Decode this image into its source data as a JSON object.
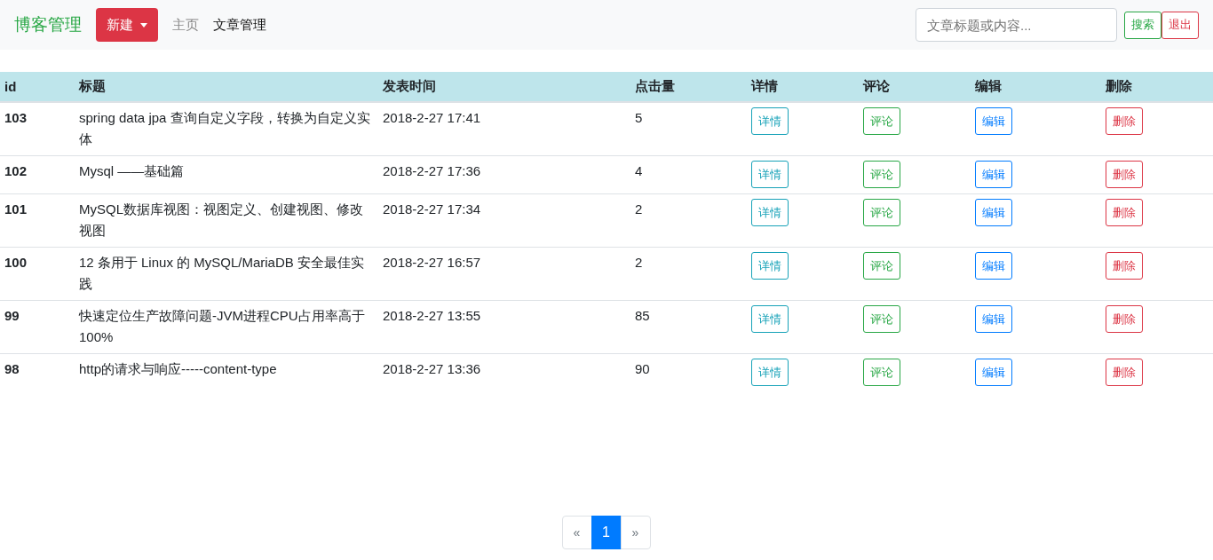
{
  "navbar": {
    "brand": "博客管理",
    "new_button": {
      "label": "新建"
    },
    "links": [
      {
        "label": "主页",
        "selected": false
      },
      {
        "label": "文章管理",
        "selected": true
      }
    ],
    "search": {
      "placeholder": "文章标题或内容..."
    },
    "buttons": [
      {
        "label": "搜索",
        "kind": "success"
      },
      {
        "label": "退出",
        "kind": "danger"
      }
    ]
  },
  "table": {
    "columns": [
      "id",
      "标题",
      "发表时间",
      "点击量",
      "详情",
      "评论",
      "编辑",
      "删除"
    ],
    "rows": [
      {
        "id": "103",
        "title": "spring data jpa 查询自定义字段，转换为自定义实体",
        "time": "2018-2-27 17:41",
        "clicks": "5",
        "actions": [
          {
            "label": "详情",
            "kind": "info"
          },
          {
            "label": "评论",
            "kind": "success"
          },
          {
            "label": "编辑",
            "kind": "primary"
          },
          {
            "label": "删除",
            "kind": "danger"
          }
        ]
      },
      {
        "id": "102",
        "title": "Mysql ——基础篇",
        "time": "2018-2-27 17:36",
        "clicks": "4",
        "actions": [
          {
            "label": "详情",
            "kind": "info"
          },
          {
            "label": "评论",
            "kind": "success"
          },
          {
            "label": "编辑",
            "kind": "primary"
          },
          {
            "label": "删除",
            "kind": "danger"
          }
        ]
      },
      {
        "id": "101",
        "title": "MySQL数据库视图：视图定义、创建视图、修改视图",
        "time": "2018-2-27 17:34",
        "clicks": "2",
        "actions": [
          {
            "label": "详情",
            "kind": "info"
          },
          {
            "label": "评论",
            "kind": "success"
          },
          {
            "label": "编辑",
            "kind": "primary"
          },
          {
            "label": "删除",
            "kind": "danger"
          }
        ]
      },
      {
        "id": "100",
        "title": "12 条用于 Linux 的 MySQL/MariaDB 安全最佳实践",
        "time": "2018-2-27 16:57",
        "clicks": "2",
        "actions": [
          {
            "label": "详情",
            "kind": "info"
          },
          {
            "label": "评论",
            "kind": "success"
          },
          {
            "label": "编辑",
            "kind": "primary"
          },
          {
            "label": "删除",
            "kind": "danger"
          }
        ]
      },
      {
        "id": "99",
        "title": "快速定位生产故障问题-JVM进程CPU占用率高于100%",
        "time": "2018-2-27 13:55",
        "clicks": "85",
        "actions": [
          {
            "label": "详情",
            "kind": "info"
          },
          {
            "label": "评论",
            "kind": "success"
          },
          {
            "label": "编辑",
            "kind": "primary"
          },
          {
            "label": "删除",
            "kind": "danger"
          }
        ]
      },
      {
        "id": "98",
        "title": "http的请求与响应-----content-type",
        "time": "2018-2-27 13:36",
        "clicks": "90",
        "actions": [
          {
            "label": "详情",
            "kind": "info"
          },
          {
            "label": "评论",
            "kind": "success"
          },
          {
            "label": "编辑",
            "kind": "primary"
          },
          {
            "label": "删除",
            "kind": "danger"
          }
        ]
      }
    ]
  },
  "pagination": [
    {
      "label": "«",
      "selected": false
    },
    {
      "label": "1",
      "selected": true
    },
    {
      "label": "»",
      "selected": false
    }
  ]
}
